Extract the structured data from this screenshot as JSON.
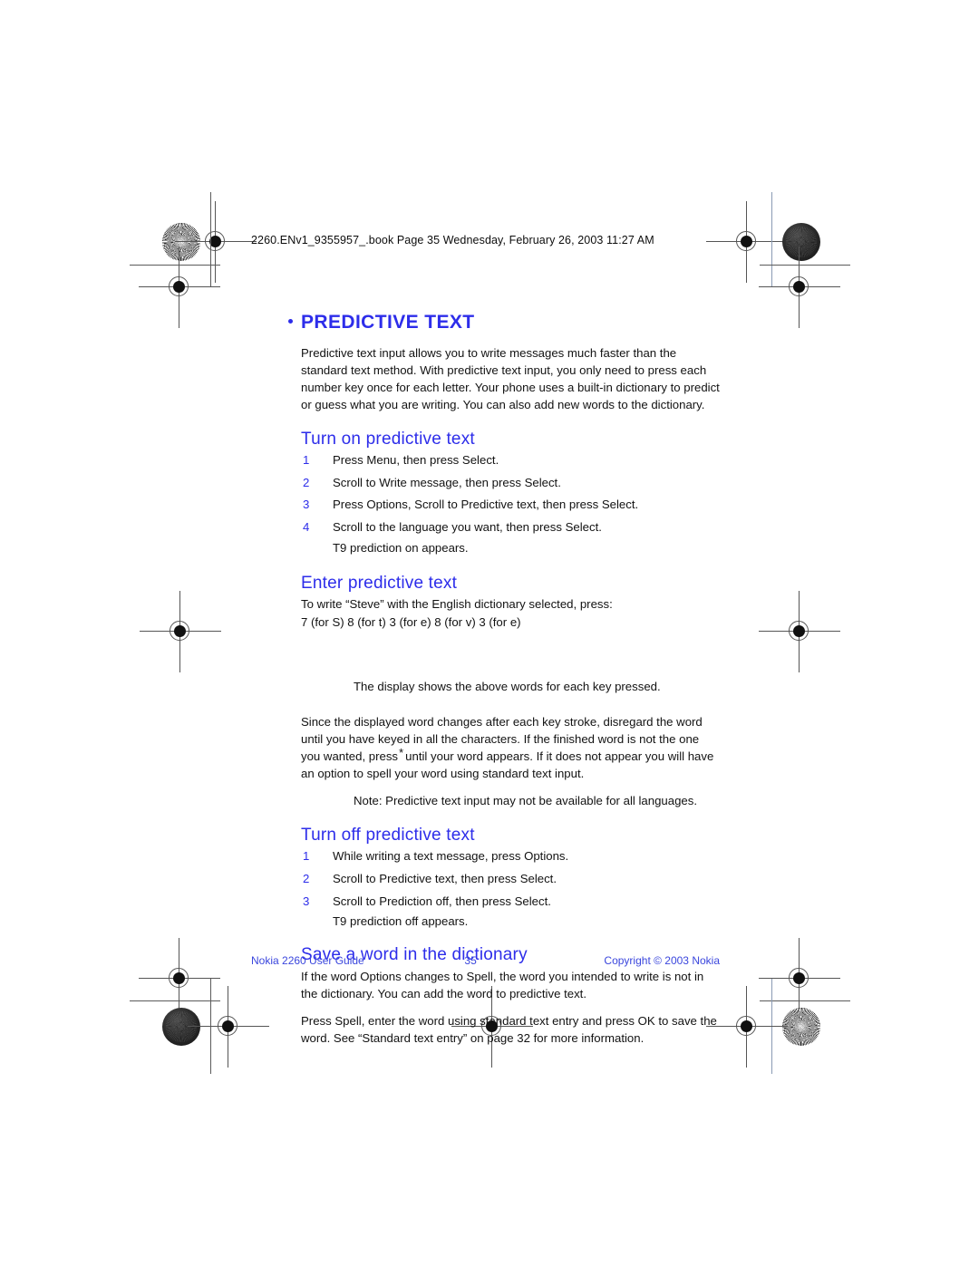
{
  "slug": "2260.ENv1_9355957_.book  Page 35  Wednesday, February 26, 2003  11:27 AM",
  "colors": {
    "heading_blue": "#2d2dea",
    "footer_blue": "#3a46dd",
    "body_black": "#121212"
  },
  "chapter": {
    "title": "PREDICTIVE TEXT",
    "intro": "Predictive text input allows you to write messages much faster than the standard text method. With predictive text input, you only need to press each number key once for each letter. Your phone uses a built-in dictionary to predict or guess what you are writing. You can also add new words to the dictionary."
  },
  "sections": [
    {
      "heading": "Turn on predictive text",
      "steps": [
        {
          "num": "1",
          "text": "Press Menu, then press Select."
        },
        {
          "num": "2",
          "text": "Scroll to Write message, then press Select."
        },
        {
          "num": "3",
          "text": "Press Options, Scroll to Predictive text, then press Select."
        },
        {
          "num": "4",
          "text": "Scroll to the language you want, then press Select."
        }
      ],
      "sub_note": "T9 prediction on appears."
    },
    {
      "heading": "Enter predictive text",
      "lead": "To write “Steve” with the English dictionary selected, press:",
      "keys": "7 (for S)  8 (for t)  3  (for e)  8 (for v)  3 (for e)",
      "display_note": "The display shows the above words for each key pressed.",
      "paragraph_part1": "Since the displayed word changes after each key stroke, disregard the word until you have keyed in all the characters. If the finished word is not the one you wanted, press",
      "paragraph_star": "*",
      "paragraph_part2": "until your word appears. If it does not appear you will have an option to spell your word using standard text input.",
      "note": "Note: Predictive text input may not be available for all languages."
    },
    {
      "heading": "Turn off predictive text",
      "steps": [
        {
          "num": "1",
          "text": "While writing a text message, press Options."
        },
        {
          "num": "2",
          "text": "Scroll to Predictive text, then press Select."
        },
        {
          "num": "3",
          "text": "Scroll to Prediction off, then press Select."
        }
      ],
      "sub_note": "T9 prediction off appears."
    },
    {
      "heading": "Save a word in the dictionary",
      "paragraph1": "If the word Options changes to Spell, the word you intended to write is not in the dictionary. You can add the word to predictive text.",
      "paragraph2": "Press Spell, enter the word using standard text entry and press OK to save the word. See “Standard text entry” on page 32 for more information."
    }
  ],
  "footer": {
    "left": "Nokia 2260 User Guide",
    "page": "35",
    "right": "Copyright © 2003 Nokia"
  }
}
